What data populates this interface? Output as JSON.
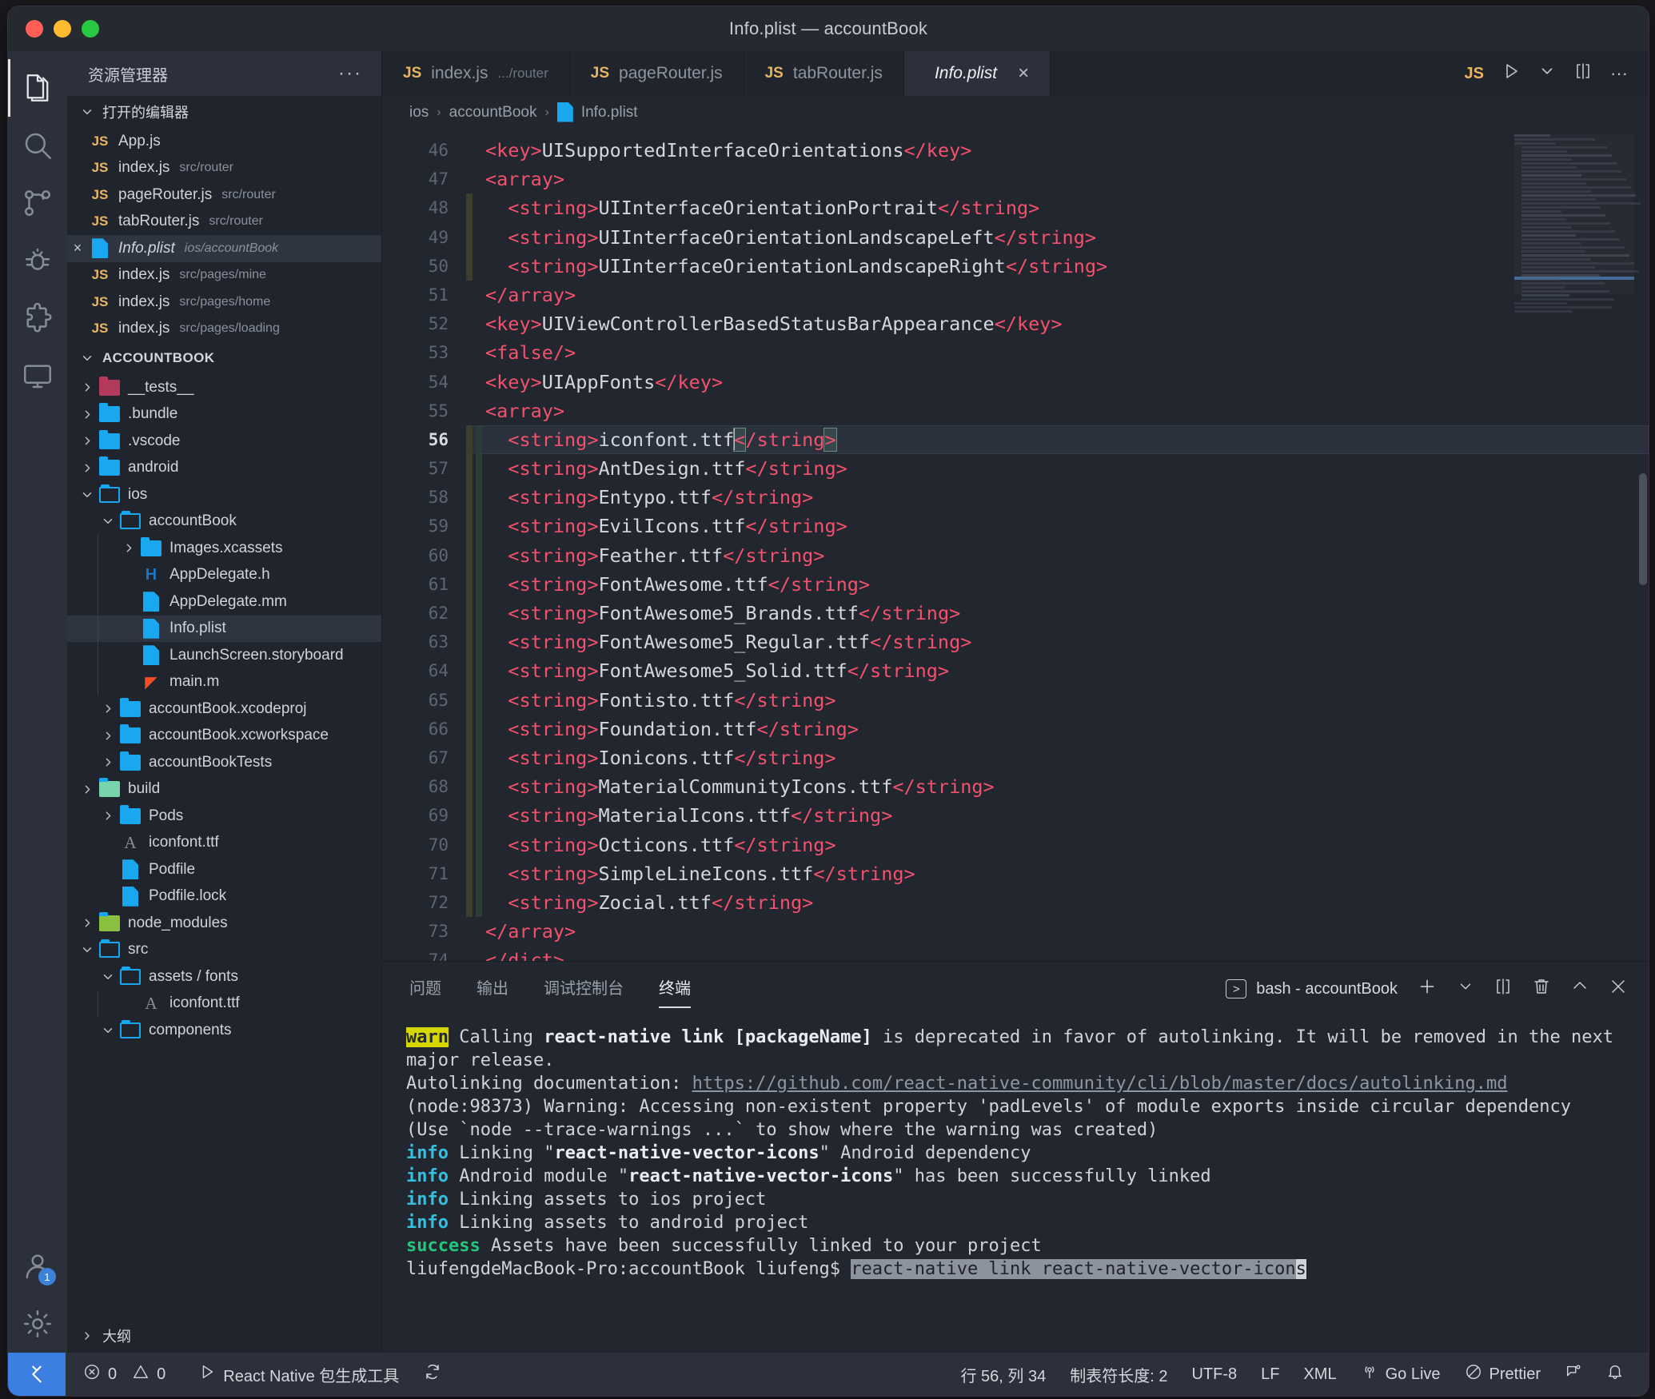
{
  "window": {
    "title": "Info.plist — accountBook"
  },
  "activitybar": {
    "items": [
      {
        "name": "explorer",
        "icon": "files-icon",
        "active": true
      },
      {
        "name": "search",
        "icon": "search-icon",
        "active": false
      },
      {
        "name": "source-control",
        "icon": "source-control-icon",
        "active": false
      },
      {
        "name": "debug",
        "icon": "debug-icon",
        "active": false
      },
      {
        "name": "extensions",
        "icon": "extensions-icon",
        "active": false
      },
      {
        "name": "remote",
        "icon": "monitor-icon",
        "active": false
      }
    ],
    "account_badge": "1"
  },
  "sidebar": {
    "header_title": "资源管理器",
    "more_actions": "···",
    "open_editors": {
      "label": "打开的编辑器",
      "items": [
        {
          "icon": "js-icon",
          "name": "App.js",
          "sub": ""
        },
        {
          "icon": "js-icon",
          "name": "index.js",
          "sub": "src/router"
        },
        {
          "icon": "js-icon",
          "name": "pageRouter.js",
          "sub": "src/router"
        },
        {
          "icon": "js-icon",
          "name": "tabRouter.js",
          "sub": "src/router"
        },
        {
          "icon": "plist-icon",
          "name": "Info.plist",
          "sub": "ios/accountBook",
          "selected": true,
          "italic": true,
          "close": "×"
        },
        {
          "icon": "js-icon",
          "name": "index.js",
          "sub": "src/pages/mine"
        },
        {
          "icon": "js-icon",
          "name": "index.js",
          "sub": "src/pages/home"
        },
        {
          "icon": "js-icon",
          "name": "index.js",
          "sub": "src/pages/loading"
        }
      ]
    },
    "project": {
      "label": "ACCOUNTBOOK",
      "items": [
        {
          "name": "__tests__",
          "depth": 0,
          "twisty": "›",
          "icon": "folder-tests-icon"
        },
        {
          "name": ".bundle",
          "depth": 0,
          "twisty": "›",
          "icon": "folder-icon"
        },
        {
          "name": ".vscode",
          "depth": 0,
          "twisty": "›",
          "icon": "folder-vscode-icon"
        },
        {
          "name": "android",
          "depth": 0,
          "twisty": "›",
          "icon": "folder-icon"
        },
        {
          "name": "ios",
          "depth": 0,
          "twisty": "⌄",
          "icon": "folder-open-icon"
        },
        {
          "name": "accountBook",
          "depth": 1,
          "twisty": "⌄",
          "icon": "folder-open-icon"
        },
        {
          "name": "Images.xcassets",
          "depth": 2,
          "twisty": "›",
          "icon": "folder-icon"
        },
        {
          "name": "AppDelegate.h",
          "depth": 2,
          "twisty": "",
          "icon": "h-icon"
        },
        {
          "name": "AppDelegate.mm",
          "depth": 2,
          "twisty": "",
          "icon": "file-icon"
        },
        {
          "name": "Info.plist",
          "depth": 2,
          "twisty": "",
          "icon": "file-icon",
          "selected": true
        },
        {
          "name": "LaunchScreen.storyboard",
          "depth": 2,
          "twisty": "",
          "icon": "file-icon"
        },
        {
          "name": "main.m",
          "depth": 2,
          "twisty": "",
          "icon": "m-icon"
        },
        {
          "name": "accountBook.xcodeproj",
          "depth": 1,
          "twisty": "›",
          "icon": "folder-icon"
        },
        {
          "name": "accountBook.xcworkspace",
          "depth": 1,
          "twisty": "›",
          "icon": "folder-icon"
        },
        {
          "name": "accountBookTests",
          "depth": 1,
          "twisty": "›",
          "icon": "folder-icon"
        },
        {
          "name": "build",
          "depth": 0,
          "twisty": "›",
          "icon": "folder-build-icon"
        },
        {
          "name": "Pods",
          "depth": 1,
          "twisty": "›",
          "icon": "folder-icon"
        },
        {
          "name": "iconfont.ttf",
          "depth": 1,
          "twisty": "",
          "icon": "font-icon"
        },
        {
          "name": "Podfile",
          "depth": 1,
          "twisty": "",
          "icon": "file-icon"
        },
        {
          "name": "Podfile.lock",
          "depth": 1,
          "twisty": "",
          "icon": "file-icon"
        },
        {
          "name": "node_modules",
          "depth": 0,
          "twisty": "›",
          "icon": "folder-node-icon"
        },
        {
          "name": "src",
          "depth": 0,
          "twisty": "⌄",
          "icon": "folder-open-icon"
        },
        {
          "name": "assets / fonts",
          "depth": 1,
          "twisty": "⌄",
          "icon": "folder-open-icon"
        },
        {
          "name": "iconfont.ttf",
          "depth": 2,
          "twisty": "",
          "icon": "font-icon"
        },
        {
          "name": "components",
          "depth": 1,
          "twisty": "⌄",
          "icon": "folder-open-icon"
        }
      ]
    },
    "outline_label": "大纲"
  },
  "tabs": [
    {
      "icon": "js-icon",
      "name": "index.js",
      "sub": ".../router",
      "active": false
    },
    {
      "icon": "js-icon",
      "name": "pageRouter.js",
      "sub": "",
      "active": false
    },
    {
      "icon": "js-icon",
      "name": "tabRouter.js",
      "sub": "",
      "active": false
    },
    {
      "icon": "plist-icon",
      "name": "Info.plist",
      "sub": "",
      "active": true,
      "close": "×"
    }
  ],
  "tab_actions": {
    "js_badge": "JS",
    "run_icon": "run-icon",
    "run_chevron": "chevron-down-icon",
    "split_icon": "split-editor-icon",
    "more_icon": "more-actions-icon"
  },
  "breadcrumb": {
    "parts": [
      "ios",
      "accountBook",
      "Info.plist"
    ],
    "separator": "›"
  },
  "editor": {
    "first_line": 46,
    "current_line": 56,
    "lines": [
      {
        "n": 46,
        "segs": [
          [
            "t",
            "<key>"
          ],
          [
            "p",
            "UISupportedInterfaceOrientations"
          ],
          [
            "t",
            "</key>"
          ]
        ]
      },
      {
        "n": 47,
        "segs": [
          [
            "t",
            "<array>"
          ]
        ]
      },
      {
        "n": 48,
        "segs": [
          [
            "p",
            "  "
          ],
          [
            "t",
            "<string>"
          ],
          [
            "p",
            "UIInterfaceOrientationPortrait"
          ],
          [
            "t",
            "</string>"
          ]
        ]
      },
      {
        "n": 49,
        "segs": [
          [
            "p",
            "  "
          ],
          [
            "t",
            "<string>"
          ],
          [
            "p",
            "UIInterfaceOrientationLandscapeLeft"
          ],
          [
            "t",
            "</string>"
          ]
        ]
      },
      {
        "n": 50,
        "segs": [
          [
            "p",
            "  "
          ],
          [
            "t",
            "<string>"
          ],
          [
            "p",
            "UIInterfaceOrientationLandscapeRight"
          ],
          [
            "t",
            "</string>"
          ]
        ]
      },
      {
        "n": 51,
        "segs": [
          [
            "t",
            "</array>"
          ]
        ]
      },
      {
        "n": 52,
        "segs": [
          [
            "t",
            "<key>"
          ],
          [
            "p",
            "UIViewControllerBasedStatusBarAppearance"
          ],
          [
            "t",
            "</key>"
          ]
        ]
      },
      {
        "n": 53,
        "segs": [
          [
            "t",
            "<false/>"
          ]
        ]
      },
      {
        "n": 54,
        "segs": [
          [
            "t",
            "<key>"
          ],
          [
            "p",
            "UIAppFonts"
          ],
          [
            "t",
            "</key>"
          ]
        ]
      },
      {
        "n": 55,
        "segs": [
          [
            "t",
            "<array>"
          ]
        ]
      },
      {
        "n": 56,
        "segs": [
          [
            "p",
            "  "
          ],
          [
            "t",
            "<string>"
          ],
          [
            "p",
            "iconfont.ttf"
          ],
          [
            "c",
            ""
          ],
          [
            "tb",
            "<"
          ],
          [
            "t",
            "/string"
          ],
          [
            "tb",
            ">"
          ]
        ],
        "highlight": true
      },
      {
        "n": 57,
        "segs": [
          [
            "p",
            "  "
          ],
          [
            "t",
            "<string>"
          ],
          [
            "p",
            "AntDesign.ttf"
          ],
          [
            "t",
            "</string>"
          ]
        ]
      },
      {
        "n": 58,
        "segs": [
          [
            "p",
            "  "
          ],
          [
            "t",
            "<string>"
          ],
          [
            "p",
            "Entypo.ttf"
          ],
          [
            "t",
            "</string>"
          ]
        ]
      },
      {
        "n": 59,
        "segs": [
          [
            "p",
            "  "
          ],
          [
            "t",
            "<string>"
          ],
          [
            "p",
            "EvilIcons.ttf"
          ],
          [
            "t",
            "</string>"
          ]
        ]
      },
      {
        "n": 60,
        "segs": [
          [
            "p",
            "  "
          ],
          [
            "t",
            "<string>"
          ],
          [
            "p",
            "Feather.ttf"
          ],
          [
            "t",
            "</string>"
          ]
        ]
      },
      {
        "n": 61,
        "segs": [
          [
            "p",
            "  "
          ],
          [
            "t",
            "<string>"
          ],
          [
            "p",
            "FontAwesome.ttf"
          ],
          [
            "t",
            "</string>"
          ]
        ]
      },
      {
        "n": 62,
        "segs": [
          [
            "p",
            "  "
          ],
          [
            "t",
            "<string>"
          ],
          [
            "p",
            "FontAwesome5_Brands.ttf"
          ],
          [
            "t",
            "</string>"
          ]
        ]
      },
      {
        "n": 63,
        "segs": [
          [
            "p",
            "  "
          ],
          [
            "t",
            "<string>"
          ],
          [
            "p",
            "FontAwesome5_Regular.ttf"
          ],
          [
            "t",
            "</string>"
          ]
        ]
      },
      {
        "n": 64,
        "segs": [
          [
            "p",
            "  "
          ],
          [
            "t",
            "<string>"
          ],
          [
            "p",
            "FontAwesome5_Solid.ttf"
          ],
          [
            "t",
            "</string>"
          ]
        ]
      },
      {
        "n": 65,
        "segs": [
          [
            "p",
            "  "
          ],
          [
            "t",
            "<string>"
          ],
          [
            "p",
            "Fontisto.ttf"
          ],
          [
            "t",
            "</string>"
          ]
        ]
      },
      {
        "n": 66,
        "segs": [
          [
            "p",
            "  "
          ],
          [
            "t",
            "<string>"
          ],
          [
            "p",
            "Foundation.ttf"
          ],
          [
            "t",
            "</string>"
          ]
        ]
      },
      {
        "n": 67,
        "segs": [
          [
            "p",
            "  "
          ],
          [
            "t",
            "<string>"
          ],
          [
            "p",
            "Ionicons.ttf"
          ],
          [
            "t",
            "</string>"
          ]
        ]
      },
      {
        "n": 68,
        "segs": [
          [
            "p",
            "  "
          ],
          [
            "t",
            "<string>"
          ],
          [
            "p",
            "MaterialCommunityIcons.ttf"
          ],
          [
            "t",
            "</string>"
          ]
        ]
      },
      {
        "n": 69,
        "segs": [
          [
            "p",
            "  "
          ],
          [
            "t",
            "<string>"
          ],
          [
            "p",
            "MaterialIcons.ttf"
          ],
          [
            "t",
            "</string>"
          ]
        ]
      },
      {
        "n": 70,
        "segs": [
          [
            "p",
            "  "
          ],
          [
            "t",
            "<string>"
          ],
          [
            "p",
            "Octicons.ttf"
          ],
          [
            "t",
            "</string>"
          ]
        ]
      },
      {
        "n": 71,
        "segs": [
          [
            "p",
            "  "
          ],
          [
            "t",
            "<string>"
          ],
          [
            "p",
            "SimpleLineIcons.ttf"
          ],
          [
            "t",
            "</string>"
          ]
        ]
      },
      {
        "n": 72,
        "segs": [
          [
            "p",
            "  "
          ],
          [
            "t",
            "<string>"
          ],
          [
            "p",
            "Zocial.ttf"
          ],
          [
            "t",
            "</string>"
          ]
        ]
      },
      {
        "n": 73,
        "segs": [
          [
            "t",
            "</array>"
          ]
        ]
      },
      {
        "n": 74,
        "segs": [
          [
            "t",
            "</dict>"
          ]
        ]
      }
    ]
  },
  "panel": {
    "tabs": [
      {
        "label": "问题",
        "active": false
      },
      {
        "label": "输出",
        "active": false
      },
      {
        "label": "调试控制台",
        "active": false
      },
      {
        "label": "终端",
        "active": true
      }
    ],
    "terminal_name": "bash - accountBook",
    "actions": [
      "new-terminal-icon",
      "chevron-down-icon",
      "split-terminal-icon",
      "trash-icon",
      "chevron-up-icon",
      "close-icon"
    ],
    "terminal_lines": [
      {
        "type": "warn",
        "tag": "warn",
        "parts": [
          [
            "n",
            " Calling "
          ],
          [
            "b",
            "react-native link [packageName]"
          ],
          [
            "n",
            " is deprecated in favor of autolinking. It will be removed in the next major release."
          ]
        ]
      },
      {
        "type": "link",
        "parts": [
          [
            "n",
            "Autolinking documentation: "
          ],
          [
            "l",
            "https://github.com/react-native-community/cli/blob/master/docs/autolinking.md"
          ]
        ]
      },
      {
        "type": "plain",
        "parts": [
          [
            "n",
            "(node:98373) Warning: Accessing non-existent property 'padLevels' of module exports inside circular dependency"
          ]
        ]
      },
      {
        "type": "plain",
        "parts": [
          [
            "n",
            "(Use `node --trace-warnings ...` to show where the warning was created)"
          ]
        ]
      },
      {
        "type": "info",
        "tag": "info",
        "parts": [
          [
            "n",
            " Linking \""
          ],
          [
            "b",
            "react-native-vector-icons"
          ],
          [
            "n",
            "\" Android dependency"
          ]
        ]
      },
      {
        "type": "info",
        "tag": "info",
        "parts": [
          [
            "n",
            " Android module \""
          ],
          [
            "b",
            "react-native-vector-icons"
          ],
          [
            "n",
            "\" has been successfully linked"
          ]
        ]
      },
      {
        "type": "info",
        "tag": "info",
        "parts": [
          [
            "n",
            " Linking assets to ios project"
          ]
        ]
      },
      {
        "type": "info",
        "tag": "info",
        "parts": [
          [
            "n",
            " Linking assets to android project"
          ]
        ]
      },
      {
        "type": "success",
        "tag": "success",
        "parts": [
          [
            "n",
            " Assets have been successfully linked to your project"
          ]
        ]
      },
      {
        "type": "prompt",
        "parts": [
          [
            "n",
            "liufengdeMacBook-Pro:accountBook liufeng$ "
          ],
          [
            "s",
            "react-native link react-native-vector-icon"
          ],
          [
            "cur",
            "s"
          ]
        ]
      }
    ]
  },
  "statusbar": {
    "remote_icon": "remote-window-icon",
    "errors": "0",
    "warnings": "0",
    "task": "React Native 包生成工具",
    "sync_icon": "sync-icon",
    "cursor_position": "行 56, 列 34",
    "tab_size": "制表符长度: 2",
    "encoding": "UTF-8",
    "eol": "LF",
    "language": "XML",
    "go_live": "Go Live",
    "prettier": "Prettier",
    "feedback_icon": "feedback-icon",
    "bell_icon": "bell-icon"
  }
}
